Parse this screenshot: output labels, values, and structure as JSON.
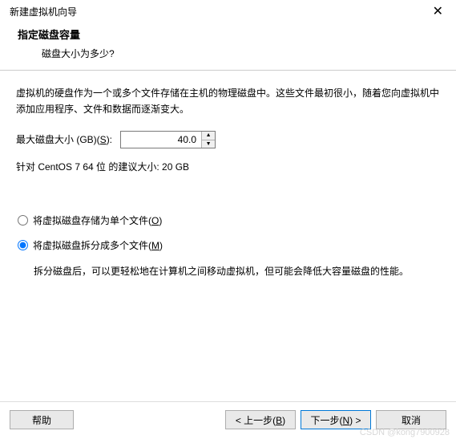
{
  "window": {
    "title": "新建虚拟机向导",
    "close": "✕"
  },
  "header": {
    "title": "指定磁盘容量",
    "subtitle": "磁盘大小为多少?"
  },
  "description": "虚拟机的硬盘作为一个或多个文件存储在主机的物理磁盘中。这些文件最初很小，随着您向虚拟机中添加应用程序、文件和数据而逐渐变大。",
  "size": {
    "label_prefix": "最大磁盘大小 (GB)(",
    "label_access": "S",
    "label_suffix": "):",
    "value": "40.0"
  },
  "recommend": "针对 CentOS 7 64 位 的建议大小: 20 GB",
  "radios": {
    "single": {
      "label_prefix": "将虚拟磁盘存储为单个文件(",
      "label_access": "O",
      "label_suffix": ")"
    },
    "split": {
      "label_prefix": "将虚拟磁盘拆分成多个文件(",
      "label_access": "M",
      "label_suffix": ")",
      "hint": "拆分磁盘后，可以更轻松地在计算机之间移动虚拟机，但可能会降低大容量磁盘的性能。"
    }
  },
  "buttons": {
    "help": "帮助",
    "back_prefix": "< 上一步(",
    "back_access": "B",
    "back_suffix": ")",
    "next_prefix": "下一步(",
    "next_access": "N",
    "next_suffix": ") >",
    "cancel": "取消"
  },
  "watermark": "CSDN @kong7900928"
}
